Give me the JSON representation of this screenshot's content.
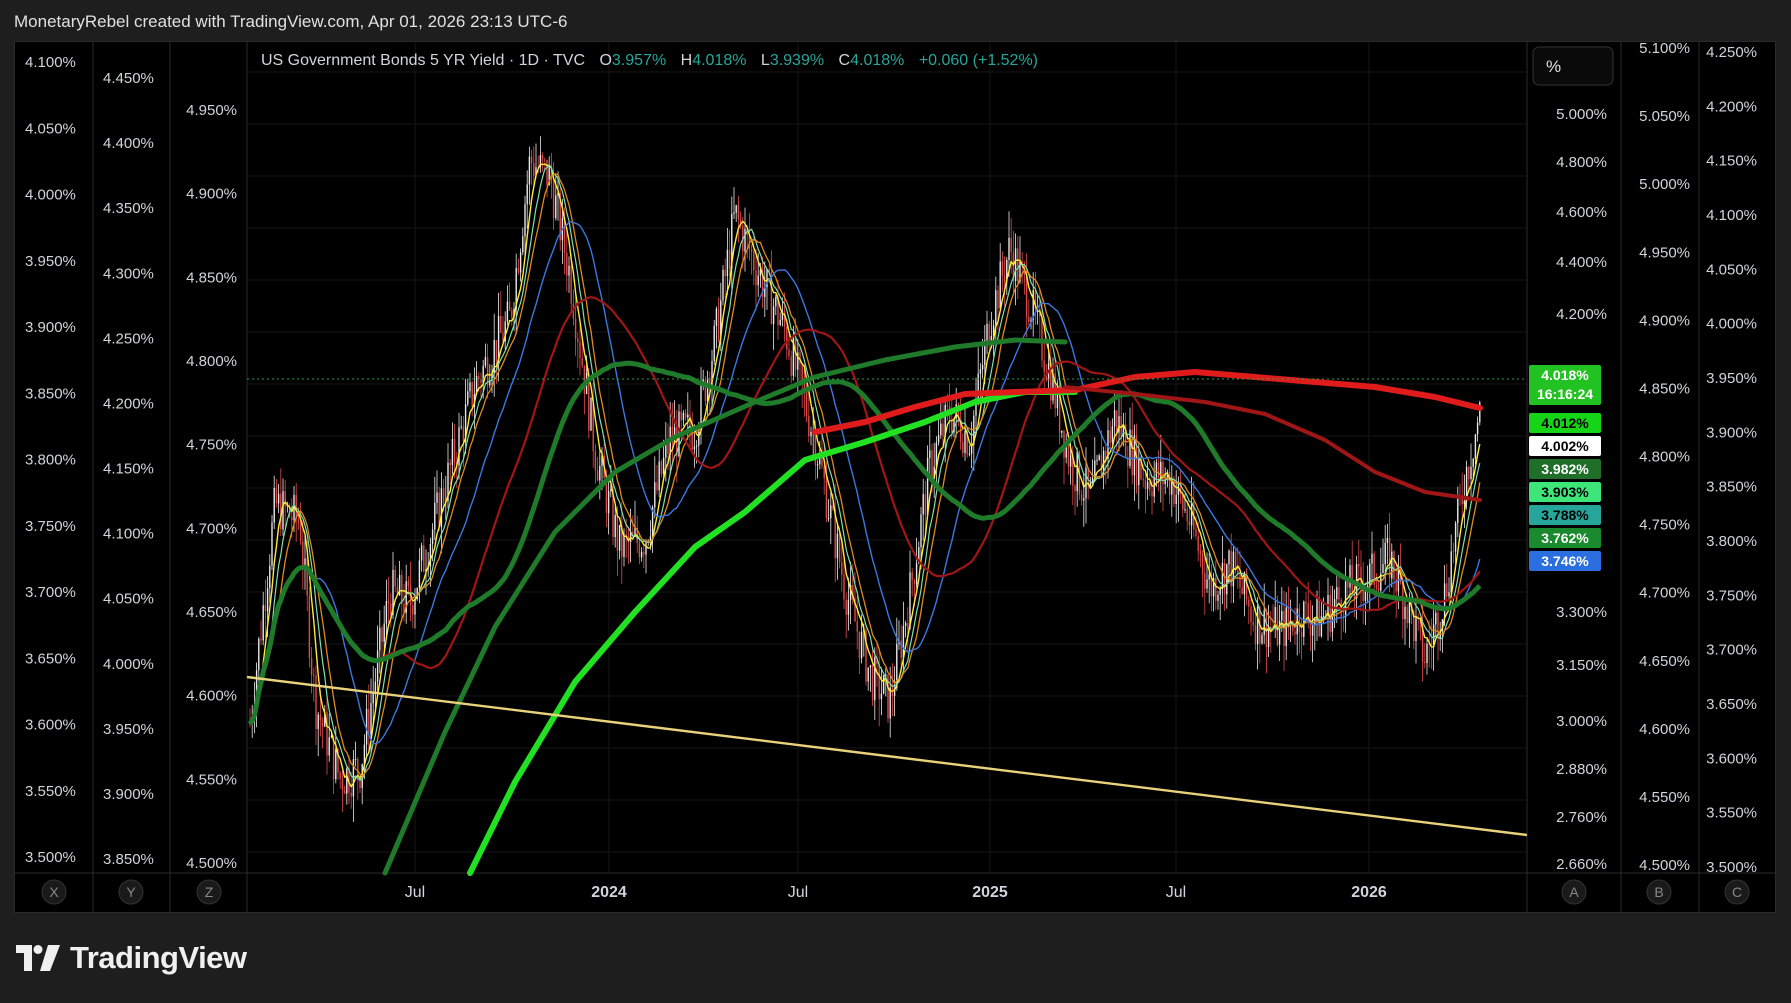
{
  "header": {
    "attribution": "MonetaryRebel created with TradingView.com, Apr 01, 2026 23:13 UTC-6"
  },
  "legend": {
    "symbol": "US Government Bonds 5 YR Yield · 1D · TVC",
    "o_label": "O",
    "o_value": "3.957%",
    "h_label": "H",
    "h_value": "4.018%",
    "l_label": "L",
    "l_value": "3.939%",
    "c_label": "C",
    "c_value": "4.018%",
    "change": "+0.060 (+1.52%)"
  },
  "percent_button": "%",
  "footer": {
    "brand": "TradingView"
  },
  "colors": {
    "background": "#000000",
    "up_green": "#26a69a",
    "price_tag": "#22c222",
    "ma_bright_green": "#22e022",
    "ma_dark_green": "#1f7a2a",
    "ma_red": "#e01b1b",
    "ma_dark_red": "#a01515",
    "ma_blue": "#3a78e0",
    "ma_orange": "#e08a1e",
    "ma_yellow": "#ffeb3b",
    "trendline": "#e8d27a"
  },
  "chart_data": {
    "type": "line",
    "title": "US Government Bonds 5 YR Yield · 1D · TVC",
    "x_ticks": [
      "Jul",
      "2024",
      "Jul",
      "2025",
      "Jul",
      "2026"
    ],
    "axis_buttons_left": [
      "X",
      "Y",
      "Z"
    ],
    "axis_buttons_right": [
      "A",
      "B",
      "C"
    ],
    "axis_X": {
      "ticks": [
        "4.100%",
        "4.050%",
        "4.000%",
        "3.950%",
        "3.900%",
        "3.850%",
        "3.800%",
        "3.750%",
        "3.700%",
        "3.650%",
        "3.600%",
        "3.550%",
        "3.500%"
      ]
    },
    "axis_Y": {
      "ticks": [
        "4.450%",
        "4.400%",
        "4.350%",
        "4.300%",
        "4.250%",
        "4.200%",
        "4.150%",
        "4.100%",
        "4.050%",
        "4.000%",
        "3.950%",
        "3.900%",
        "3.850%"
      ]
    },
    "axis_Z": {
      "ticks": [
        "4.950%",
        "4.900%",
        "4.850%",
        "4.800%",
        "4.750%",
        "4.700%",
        "4.650%",
        "4.600%",
        "4.550%",
        "4.500%"
      ]
    },
    "axis_A": {
      "log_scale": true,
      "ticks": [
        "5.000%",
        "4.800%",
        "4.600%",
        "4.400%",
        "4.200%",
        "3.300%",
        "3.150%",
        "3.000%",
        "2.880%",
        "2.760%",
        "2.660%"
      ]
    },
    "axis_B": {
      "ticks": [
        "5.100%",
        "5.050%",
        "5.000%",
        "4.950%",
        "4.900%",
        "4.850%",
        "4.800%",
        "4.750%",
        "4.700%",
        "4.650%",
        "4.600%",
        "4.550%",
        "4.500%"
      ]
    },
    "axis_C": {
      "ticks": [
        "4.250%",
        "4.200%",
        "4.150%",
        "4.100%",
        "4.050%",
        "4.000%",
        "3.950%",
        "3.900%",
        "3.850%",
        "3.800%",
        "3.750%",
        "3.700%",
        "3.650%",
        "3.600%",
        "3.550%",
        "3.500%"
      ]
    },
    "price_tags": [
      {
        "label": "4.018%",
        "sub": "16:16:24",
        "color": "#22c222",
        "text_color": "#ffffff"
      },
      {
        "label": "4.012%",
        "color": "#16d416",
        "text_color": "#000000"
      },
      {
        "label": "4.002%",
        "color": "#ffffff",
        "text_color": "#000000"
      },
      {
        "label": "3.982%",
        "color": "#1f6e2a",
        "text_color": "#ffffff"
      },
      {
        "label": "3.903%",
        "color": "#3ee67a",
        "text_color": "#000000"
      },
      {
        "label": "3.788%",
        "color": "#26a69a",
        "text_color": "#000000"
      },
      {
        "label": "3.762%",
        "color": "#1a8a2e",
        "text_color": "#ffffff"
      },
      {
        "label": "3.746%",
        "color": "#2a6ee0",
        "text_color": "#ffffff"
      }
    ],
    "last_price": 4.018,
    "price_range": [
      3.68,
      4.98
    ]
  }
}
